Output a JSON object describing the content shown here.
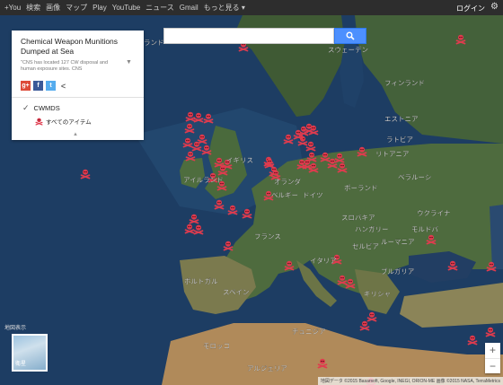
{
  "topbar": {
    "items": [
      "+You",
      "検索",
      "画像",
      "マップ",
      "Play",
      "YouTube",
      "ニュース",
      "Gmail",
      "もっと見る ▾"
    ],
    "login": "ログイン"
  },
  "search": {
    "placeholder": "",
    "value": ""
  },
  "panel": {
    "title": "Chemical Weapon Munitions Dumped at Sea",
    "description": "\"CNS has located 127 CW disposal and human exposure sites. CNS",
    "layer_name": "CWMDS",
    "layer_item": "すべてのアイテム"
  },
  "map_labels": [
    {
      "id": "uk",
      "text": "イギリス"
    },
    {
      "id": "ireland",
      "text": "アイルランド"
    },
    {
      "id": "sweden",
      "text": "スウェーデン"
    },
    {
      "id": "finland",
      "text": "フィンランド"
    },
    {
      "id": "estonia",
      "text": "エストニア"
    },
    {
      "id": "latvia",
      "text": "ラトビア"
    },
    {
      "id": "lithuania",
      "text": "リトアニア"
    },
    {
      "id": "belarus",
      "text": "ベラルーシ"
    },
    {
      "id": "poland",
      "text": "ポーランド"
    },
    {
      "id": "germany",
      "text": "ドイツ"
    },
    {
      "id": "netherlands",
      "text": "オランダ"
    },
    {
      "id": "belgium",
      "text": "ベルギー"
    },
    {
      "id": "france",
      "text": "フランス"
    },
    {
      "id": "ukraine",
      "text": "ウクライナ"
    },
    {
      "id": "moldova",
      "text": "モルドバ"
    },
    {
      "id": "romania",
      "text": "ルーマニア"
    },
    {
      "id": "bulgaria",
      "text": "ブルガリア"
    },
    {
      "id": "italy",
      "text": "イタリア"
    },
    {
      "id": "greece",
      "text": "ギリシャ"
    },
    {
      "id": "portugal",
      "text": "ポルトガル"
    },
    {
      "id": "spain",
      "text": "スペイン"
    },
    {
      "id": "morocco",
      "text": "モロッコ"
    },
    {
      "id": "algeria",
      "text": "アルジェリア"
    },
    {
      "id": "tunisia",
      "text": "チュニジア"
    },
    {
      "id": "slovakia",
      "text": "スロバキア"
    },
    {
      "id": "serbia",
      "text": "セルビア"
    },
    {
      "id": "hungary",
      "text": "ハンガリー"
    },
    {
      "id": "finland_w",
      "text": "ランド"
    }
  ],
  "minimap_label": "衛星",
  "minimap_caption": "地図表示",
  "zoom": {
    "in": "+",
    "out": "−"
  },
  "attribution": "地図データ ©2015 Basarsoft, Google, INEGI, ORION-ME 画像 ©2015 NASA, TerraMetrics",
  "colors": {
    "marker": "#e03b4e",
    "search_button": "#4d90fe",
    "topbar": "#2d2d2d"
  }
}
